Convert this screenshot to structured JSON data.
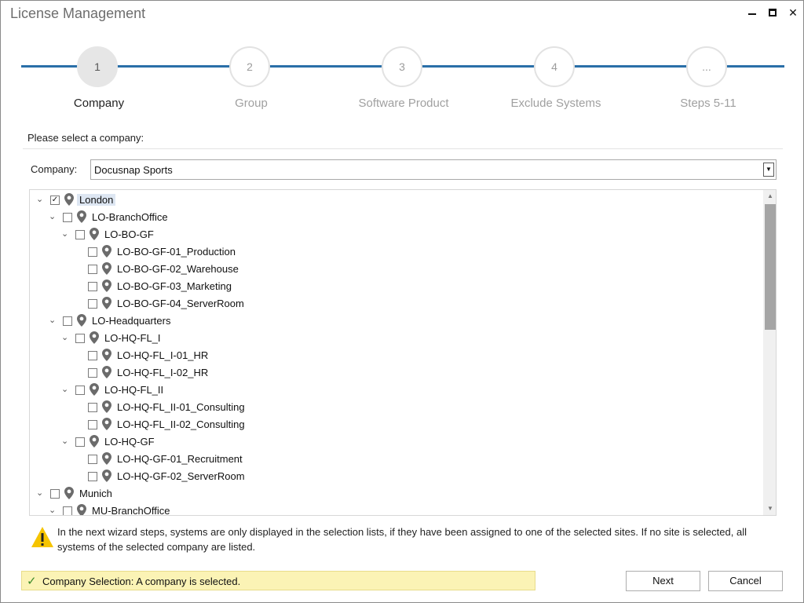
{
  "window": {
    "title": "License Management"
  },
  "steps": [
    {
      "number": "1",
      "label": "Company"
    },
    {
      "number": "2",
      "label": "Group"
    },
    {
      "number": "3",
      "label": "Software Product"
    },
    {
      "number": "4",
      "label": "Exclude Systems"
    },
    {
      "number": "...",
      "label": "Steps 5-11"
    }
  ],
  "instruction": "Please select a company:",
  "company": {
    "label": "Company:",
    "value": "Docusnap Sports"
  },
  "tree": [
    {
      "label": "London",
      "level": 0,
      "expanded": true,
      "checked": true,
      "highlight": true
    },
    {
      "label": "LO-BranchOffice",
      "level": 1,
      "expanded": true,
      "checked": false
    },
    {
      "label": "LO-BO-GF",
      "level": 2,
      "expanded": true,
      "checked": false
    },
    {
      "label": "LO-BO-GF-01_Production",
      "level": 3,
      "checked": false
    },
    {
      "label": "LO-BO-GF-02_Warehouse",
      "level": 3,
      "checked": false
    },
    {
      "label": "LO-BO-GF-03_Marketing",
      "level": 3,
      "checked": false
    },
    {
      "label": "LO-BO-GF-04_ServerRoom",
      "level": 3,
      "checked": false
    },
    {
      "label": "LO-Headquarters",
      "level": 1,
      "expanded": true,
      "checked": false
    },
    {
      "label": "LO-HQ-FL_I",
      "level": 2,
      "expanded": true,
      "checked": false
    },
    {
      "label": "LO-HQ-FL_I-01_HR",
      "level": 3,
      "checked": false
    },
    {
      "label": "LO-HQ-FL_I-02_HR",
      "level": 3,
      "checked": false
    },
    {
      "label": "LO-HQ-FL_II",
      "level": 2,
      "expanded": true,
      "checked": false
    },
    {
      "label": "LO-HQ-FL_II-01_Consulting",
      "level": 3,
      "checked": false
    },
    {
      "label": "LO-HQ-FL_II-02_Consulting",
      "level": 3,
      "checked": false
    },
    {
      "label": "LO-HQ-GF",
      "level": 2,
      "expanded": true,
      "checked": false
    },
    {
      "label": "LO-HQ-GF-01_Recruitment",
      "level": 3,
      "checked": false
    },
    {
      "label": "LO-HQ-GF-02_ServerRoom",
      "level": 3,
      "checked": false
    },
    {
      "label": "Munich",
      "level": 0,
      "expanded": true,
      "checked": false
    },
    {
      "label": "MU-BranchOffice",
      "level": 1,
      "expanded": true,
      "checked": false
    }
  ],
  "warning": "In the next wizard steps, systems are only displayed in the selection lists, if they have been assigned to one of the selected sites. If no site is selected, all systems of the selected company are listed.",
  "status": "Company Selection: A company is selected.",
  "buttons": {
    "next": "Next",
    "cancel": "Cancel"
  },
  "colors": {
    "accent": "#2a6fa8",
    "status_bg": "#fbf3b5",
    "status_check": "#3d8a2a",
    "selection": "#dde6f2"
  },
  "icons": {
    "tree_node": "location-pin-icon",
    "warning": "warning-triangle-icon",
    "status": "checkmark-icon"
  }
}
